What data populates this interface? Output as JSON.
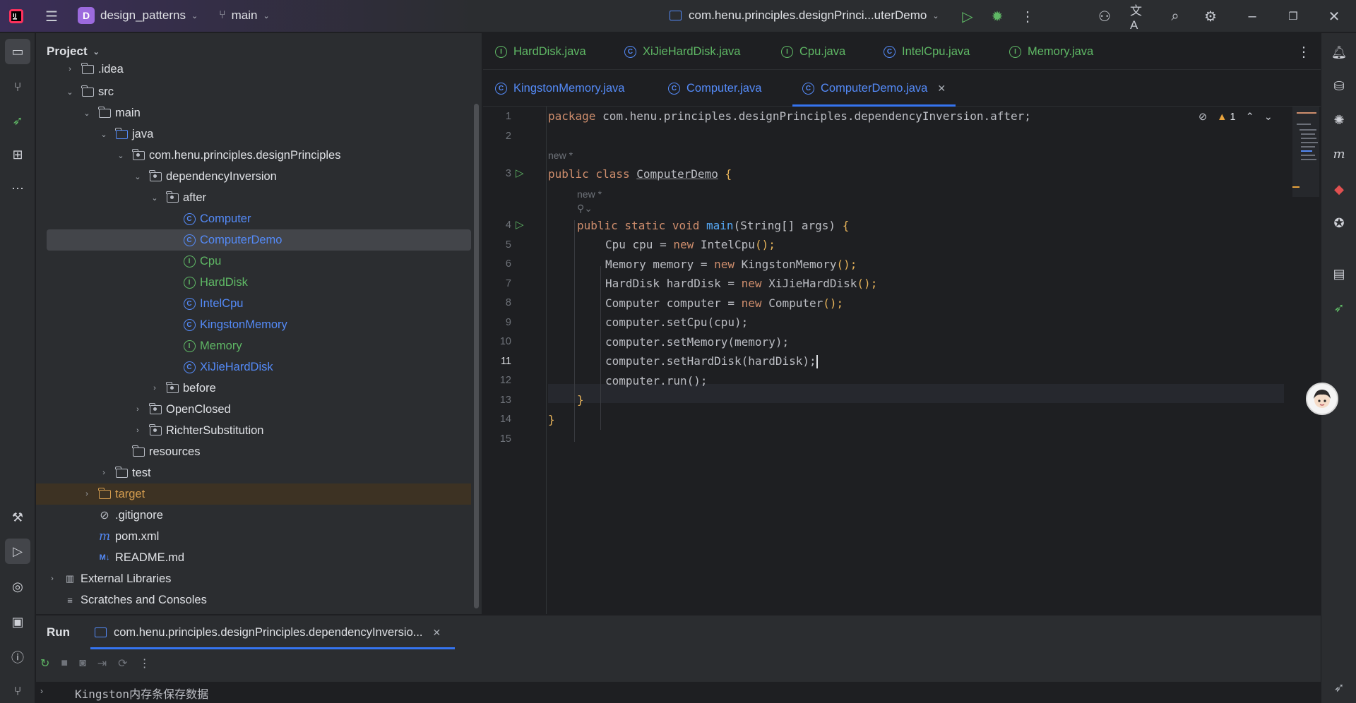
{
  "titlebar": {
    "project_badge": "D",
    "project_name": "design_patterns",
    "branch": "main",
    "run_config": "com.henu.principles.designPrinci...uterDemo"
  },
  "project_panel": {
    "title": "Project",
    "tree": [
      {
        "label": ".idea",
        "kind": "folder"
      },
      {
        "label": "src",
        "kind": "folder"
      },
      {
        "label": "main",
        "kind": "folder"
      },
      {
        "label": "java",
        "kind": "folder-blue"
      },
      {
        "label": "com.henu.principles.designPrinciples",
        "kind": "package"
      },
      {
        "label": "dependencyInversion",
        "kind": "package"
      },
      {
        "label": "after",
        "kind": "package"
      },
      {
        "label": "Computer",
        "kind": "class"
      },
      {
        "label": "ComputerDemo",
        "kind": "class"
      },
      {
        "label": "Cpu",
        "kind": "interface"
      },
      {
        "label": "HardDisk",
        "kind": "interface"
      },
      {
        "label": "IntelCpu",
        "kind": "class"
      },
      {
        "label": "KingstonMemory",
        "kind": "class"
      },
      {
        "label": "Memory",
        "kind": "interface"
      },
      {
        "label": "XiJieHardDisk",
        "kind": "class"
      },
      {
        "label": "before",
        "kind": "package"
      },
      {
        "label": "OpenClosed",
        "kind": "package"
      },
      {
        "label": "RichterSubstitution",
        "kind": "package"
      },
      {
        "label": "resources",
        "kind": "folder"
      },
      {
        "label": "test",
        "kind": "folder"
      },
      {
        "label": "target",
        "kind": "folder-orange"
      },
      {
        "label": ".gitignore",
        "kind": "file"
      },
      {
        "label": "pom.xml",
        "kind": "maven"
      },
      {
        "label": "README.md",
        "kind": "markdown"
      },
      {
        "label": "External Libraries",
        "kind": "libs"
      },
      {
        "label": "Scratches and Consoles",
        "kind": "scratch"
      }
    ]
  },
  "editor": {
    "tabs_row1": [
      "HardDisk.java",
      "XiJieHardDisk.java",
      "Cpu.java",
      "IntelCpu.java",
      "Memory.java"
    ],
    "tabs_row2": [
      "KingstonMemory.java",
      "Computer.java",
      "ComputerDemo.java"
    ],
    "warnings": "1",
    "hint_new": "new *",
    "line_numbers": [
      "1",
      "2",
      "3",
      "4",
      "5",
      "6",
      "7",
      "8",
      "9",
      "10",
      "11",
      "12",
      "13",
      "14",
      "15"
    ],
    "code": {
      "l1_kw": "package",
      "l1_rest": " com.henu.principles.designPrinciples.dependencyInversion.after;",
      "l3_kw": "public class",
      "l3_name": "ComputerDemo",
      "l3_brace": " {",
      "l4_kw": "public static void",
      "l4_fn": "main",
      "l4_rest": "(String[] args) ",
      "l4_brace": "{",
      "l5_a": "Cpu cpu = ",
      "l5_new": "new",
      "l5_b": " IntelCpu",
      "l5_c": "();",
      "l6_a": "Memory memory = ",
      "l6_new": "new",
      "l6_b": " KingstonMemory",
      "l6_c": "();",
      "l7_a": "HardDisk hardDisk = ",
      "l7_new": "new",
      "l7_b": " XiJieHardDisk",
      "l7_c": "();",
      "l8_a": "Computer computer = ",
      "l8_new": "new",
      "l8_b": " Computer",
      "l8_c": "();",
      "l9": "computer.setCpu(cpu);",
      "l10": "computer.setMemory(memory);",
      "l11": "computer.setHardDisk(hardDisk);",
      "l12": "computer.run();",
      "l13": "}",
      "l14": "}"
    }
  },
  "run_panel": {
    "title": "Run",
    "tab_label": "com.henu.principles.designPrinciples.dependencyInversio...",
    "output": "Kingston内存条保存数据"
  }
}
